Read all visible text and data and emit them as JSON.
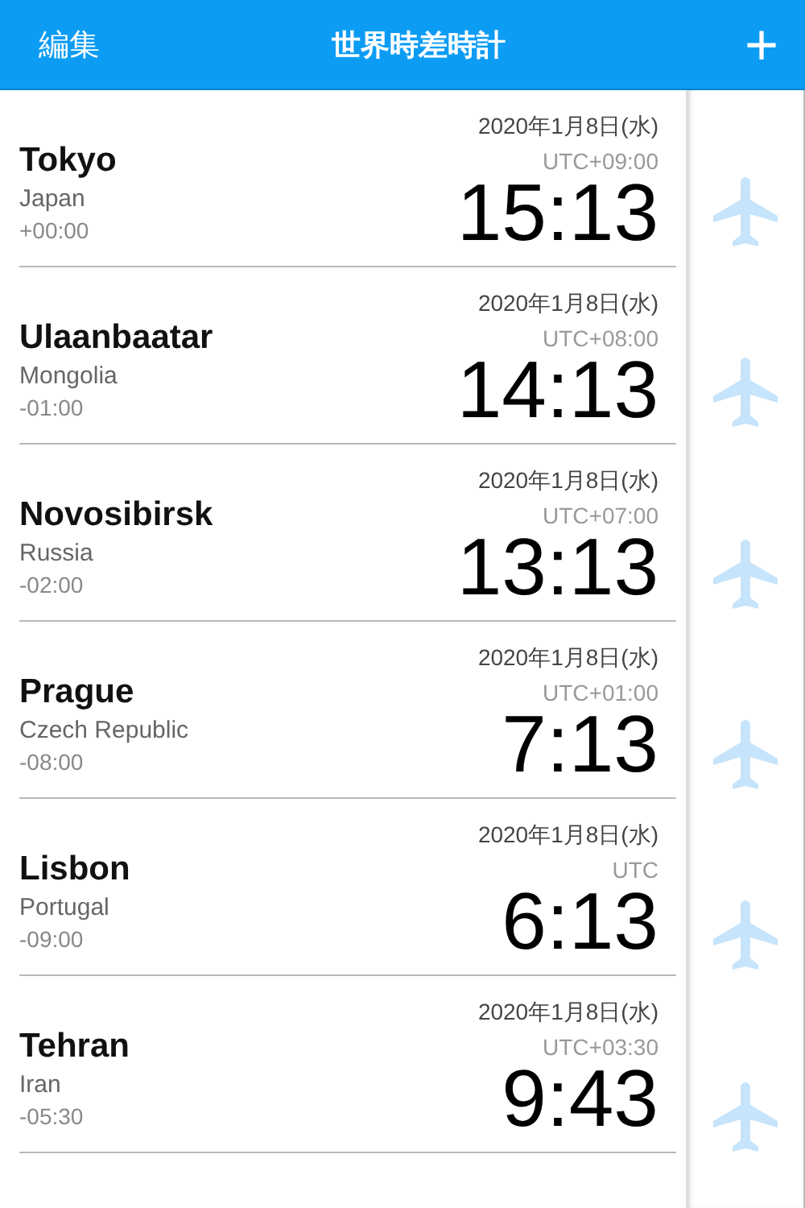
{
  "header": {
    "left_button": "編集",
    "title": "世界時差時計",
    "right_button": "+"
  },
  "cities": [
    {
      "city": "Tokyo",
      "country": "Japan",
      "offset": "+00:00",
      "date": "2020年1月8日(水)",
      "zone": "UTC+09:00",
      "time": "15:13"
    },
    {
      "city": "Ulaanbaatar",
      "country": "Mongolia",
      "offset": "-01:00",
      "date": "2020年1月8日(水)",
      "zone": "UTC+08:00",
      "time": "14:13"
    },
    {
      "city": "Novosibirsk",
      "country": "Russia",
      "offset": "-02:00",
      "date": "2020年1月8日(水)",
      "zone": "UTC+07:00",
      "time": "13:13"
    },
    {
      "city": "Prague",
      "country": "Czech Republic",
      "offset": "-08:00",
      "date": "2020年1月8日(水)",
      "zone": "UTC+01:00",
      "time": "7:13"
    },
    {
      "city": "Lisbon",
      "country": "Portugal",
      "offset": "-09:00",
      "date": "2020年1月8日(水)",
      "zone": "UTC",
      "time": "6:13"
    },
    {
      "city": "Tehran",
      "country": "Iran",
      "offset": "-05:30",
      "date": "2020年1月8日(水)",
      "zone": "UTC+03:30",
      "time": "9:43"
    }
  ]
}
